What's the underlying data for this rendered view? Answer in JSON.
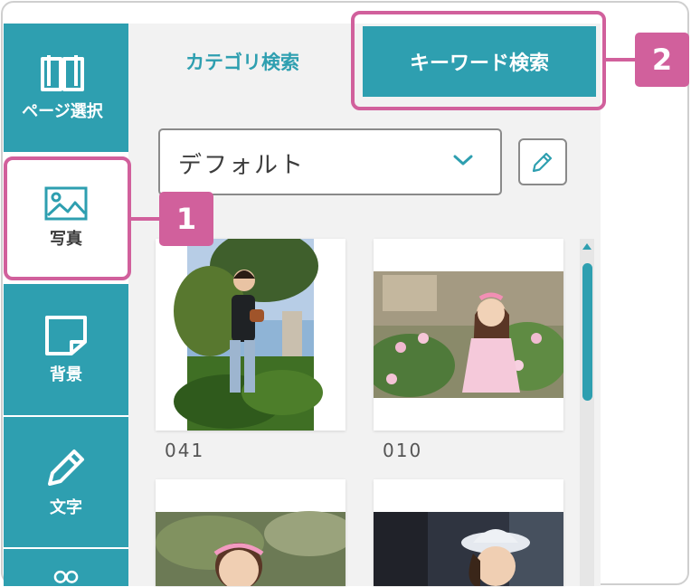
{
  "sidebar": {
    "items": [
      {
        "label": "ページ選択",
        "icon": "book-icon",
        "active": false
      },
      {
        "label": "写真",
        "icon": "image-icon",
        "active": true
      },
      {
        "label": "背景",
        "icon": "sticky-note-icon",
        "active": false
      },
      {
        "label": "文字",
        "icon": "pencil-icon",
        "active": false
      }
    ]
  },
  "tabs": {
    "category_label": "カテゴリ検索",
    "keyword_label": "キーワード検索",
    "active": "keyword"
  },
  "album_select": {
    "value": "デフォルト"
  },
  "photos": [
    {
      "label": "041"
    },
    {
      "label": "010"
    },
    {
      "label": ""
    },
    {
      "label": ""
    }
  ],
  "callouts": [
    {
      "number": "1",
      "target": "写真"
    },
    {
      "number": "2",
      "target": "キーワード検索"
    }
  ],
  "colors": {
    "accent": "#2e9fb0",
    "highlight": "#d1609c",
    "panel": "#f2f2f2"
  }
}
